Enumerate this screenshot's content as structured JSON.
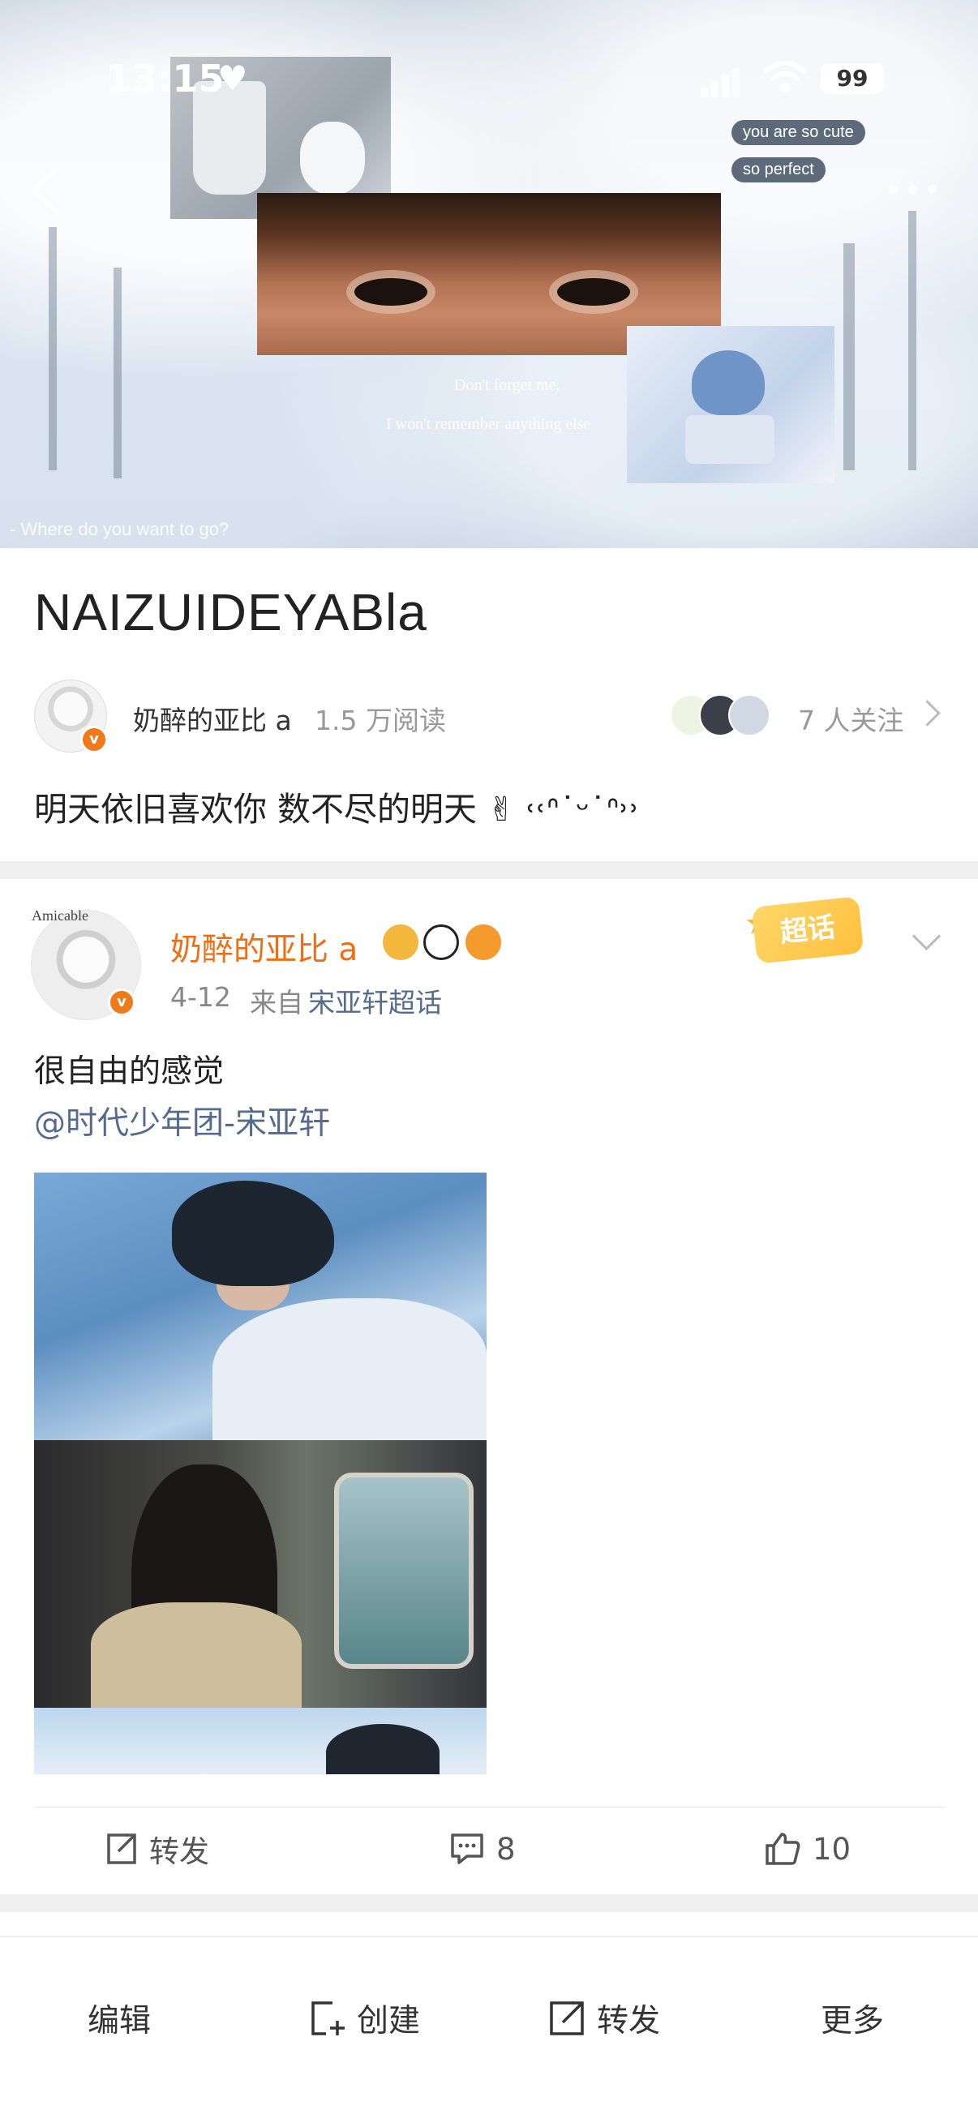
{
  "status_bar": {
    "time": "13:15",
    "battery": "99"
  },
  "hero": {
    "bubbles": [
      "you are so cute",
      "so perfect"
    ],
    "overlay_text": [
      "Don't forget me.",
      "I won't remember anything else"
    ],
    "caption": "- Where do you want to go?",
    "photo_label": "Amicable"
  },
  "topic": {
    "title": "NAIZUIDEYABla",
    "host_name": "奶醉的亚比 a",
    "reads": "1.5 万阅读",
    "followers": "7 人关注",
    "description": "明天依旧喜欢你 数不尽的明天 ✌︎ ˓˓ᐢ˙ᵕ˙ᐢ˒˒"
  },
  "post": {
    "username": "奶醉的亚比 a",
    "date": "4-12",
    "source_prefix": "来自",
    "source": "宋亚轩超话",
    "badge": "超话",
    "text": "很自由的感觉",
    "mention": "@时代少年团-宋亚轩",
    "actions": {
      "repost": "转发",
      "comments": "8",
      "likes": "10"
    }
  },
  "bottom_bar": {
    "edit": "编辑",
    "create": "创建",
    "repost": "转发",
    "more": "更多"
  }
}
